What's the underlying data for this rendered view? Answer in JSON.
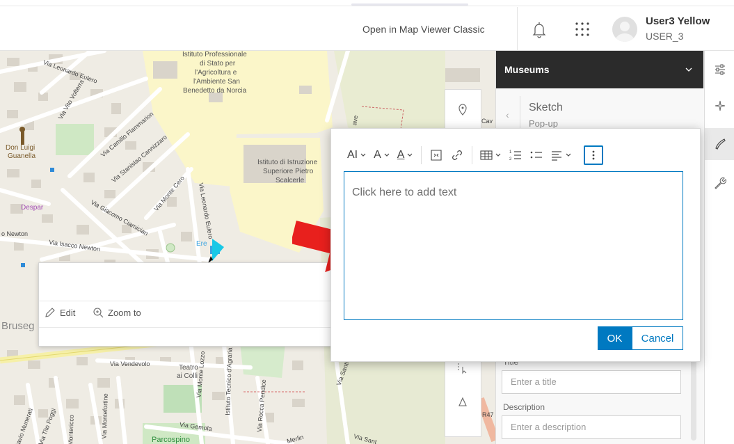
{
  "header": {
    "open_classic": "Open in Map Viewer Classic",
    "user_name": "User3 Yellow",
    "user_id": "USER_3"
  },
  "map": {
    "labels": {
      "istituto_prof": "Istituto Professionale",
      "istituto_prof2": "di Stato per",
      "istituto_prof3": "l'Agricoltura e",
      "istituto_prof4": "l'Ambiente San",
      "istituto_prof5": "Benedetto da Norcia",
      "istituto_istr": "Istituto di Istruzione",
      "istituto_istr2": "Superiore Pietro",
      "istituto_istr3": "Scalcerle",
      "don_luigi": "Don Luigi",
      "guanella": "Guanella",
      "despar": "Despar",
      "via_leonardo_eulero": "Via Leonardo Eulero",
      "via_vittoria": "Via Vito Volterra",
      "via_camillo": "Via Camillo Flammarion",
      "via_stanislao": "Via Stanislao Cannizzaro",
      "via_monte_cero": "Via Monte Cero",
      "via_leonardo_eulero2": "Via Leonardo Eulero",
      "via_giacomo": "Via Giacomo Ciamician",
      "newton": "o Newton",
      "via_isacco": "Via Isacco Newton",
      "brusegana": "Bruseg",
      "via_vendevolo": "Via Vendevolo",
      "teatro": "Teatro",
      "ai_colli": "ai Colli",
      "via_monte_lozzo": "Via Monte Lozzo",
      "istituto_tecnico": "Istituto Tecnico d'Agraria",
      "via_rocca_pendice": "Via Rocca Pendice",
      "via_santi": "Via Santi F",
      "via_monte": "Via Montefortine",
      "via_montericco": "Montericco",
      "via_tito_poggi": "Via Tito Poggi",
      "ottavio_munerati": "Ottavio Munerati",
      "via_gemola": "Via Gemola",
      "parcospino": "Parcospino",
      "merlin": "Merlin",
      "via_sant": "Via Sant",
      "r47": "R47",
      "cav": "Cav",
      "ave": "ave",
      "ere": "Ere"
    }
  },
  "left_popup": {
    "edit_label": "Edit",
    "zoom_label": "Zoom to"
  },
  "side_panel": {
    "layer_name": "Museums",
    "sketch_title": "Sketch",
    "sketch_sub": "Pop-up",
    "title_label": "Title",
    "title_placeholder": "Enter a title",
    "description_label": "Description",
    "description_placeholder": "Enter a description"
  },
  "editor": {
    "placeholder": "Click here to add text",
    "ok_label": "OK",
    "cancel_label": "Cancel",
    "toolbar": {
      "font_size": "AI",
      "font_style": "A",
      "font_color": "A"
    }
  },
  "colors": {
    "accent": "#0079c1",
    "layer_bar": "#2b2b2b",
    "arrow": "#e8201d"
  }
}
